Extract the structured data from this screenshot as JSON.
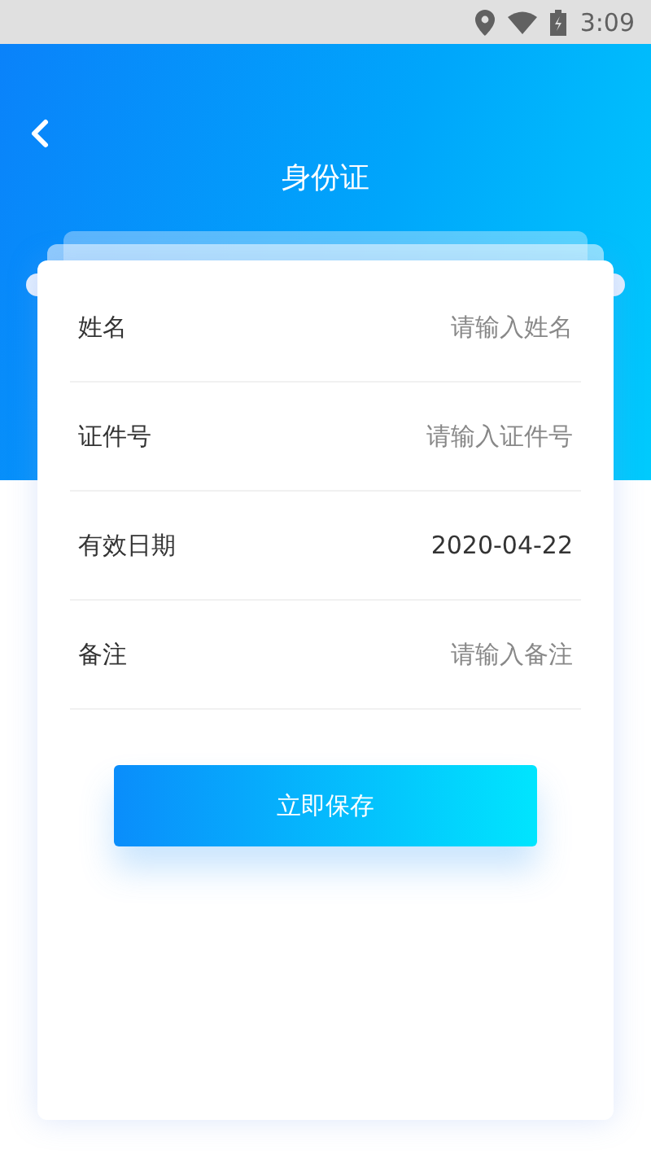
{
  "status_bar": {
    "time": "3:09"
  },
  "header": {
    "title": "身份证"
  },
  "fields": [
    {
      "kind": "input",
      "label": "姓名",
      "placeholder": "请输入姓名"
    },
    {
      "kind": "input",
      "label": "证件号",
      "placeholder": "请输入证件号"
    },
    {
      "kind": "date",
      "label": "有效日期",
      "value": "2020-04-22"
    },
    {
      "kind": "input",
      "label": "备注",
      "placeholder": "请输入备注"
    }
  ],
  "buttons": [
    "立即保存"
  ]
}
